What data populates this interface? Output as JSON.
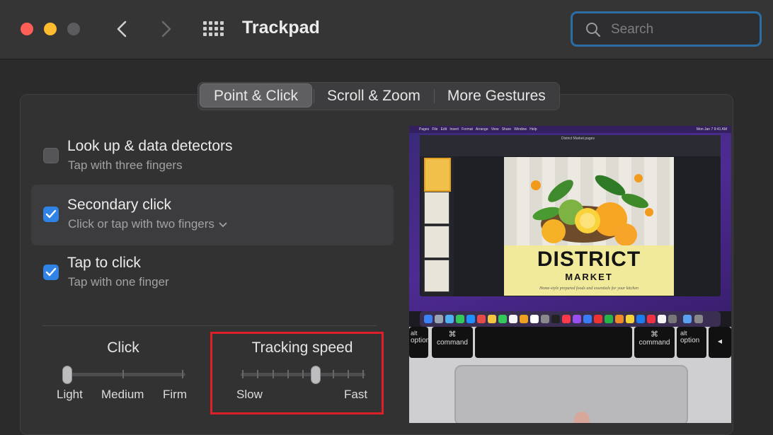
{
  "window": {
    "title": "Trackpad",
    "search_placeholder": "Search",
    "accent_color": "#2c6ea3"
  },
  "tabs": [
    {
      "label": "Point & Click",
      "active": true
    },
    {
      "label": "Scroll & Zoom",
      "active": false
    },
    {
      "label": "More Gestures",
      "active": false
    }
  ],
  "options": [
    {
      "title": "Look up & data detectors",
      "subtitle": "Tap with three fingers",
      "checked": false,
      "selected": false
    },
    {
      "title": "Secondary click",
      "subtitle": "Click or tap with two fingers",
      "checked": true,
      "selected": true,
      "has_dropdown": true
    },
    {
      "title": "Tap to click",
      "subtitle": "Tap with one finger",
      "checked": true,
      "selected": false
    }
  ],
  "click_slider": {
    "title": "Click",
    "labels": [
      "Light",
      "Medium",
      "Firm"
    ],
    "value_index": 0
  },
  "tracking_slider": {
    "title": "Tracking speed",
    "min_label": "Slow",
    "max_label": "Fast",
    "value_fraction": 0.6,
    "highlight_color": "#dc1f28"
  },
  "preview": {
    "menu_items": [
      "Pages",
      "File",
      "Edit",
      "Insert",
      "Format",
      "Arrange",
      "View",
      "Share",
      "Window",
      "Help"
    ],
    "menu_clock": "Mon Jan 7  9:41 AM",
    "document_name": "District Market.pages",
    "poster_title": "DISTRICT",
    "poster_subtitle": "MARKET",
    "poster_tagline": "Home-style prepared foods and essentials for your kitchen",
    "keys": {
      "left_option": "option",
      "left_command": "command",
      "right_command": "command",
      "right_option": "option",
      "command_symbol": "⌘",
      "alt_label": "alt"
    }
  }
}
